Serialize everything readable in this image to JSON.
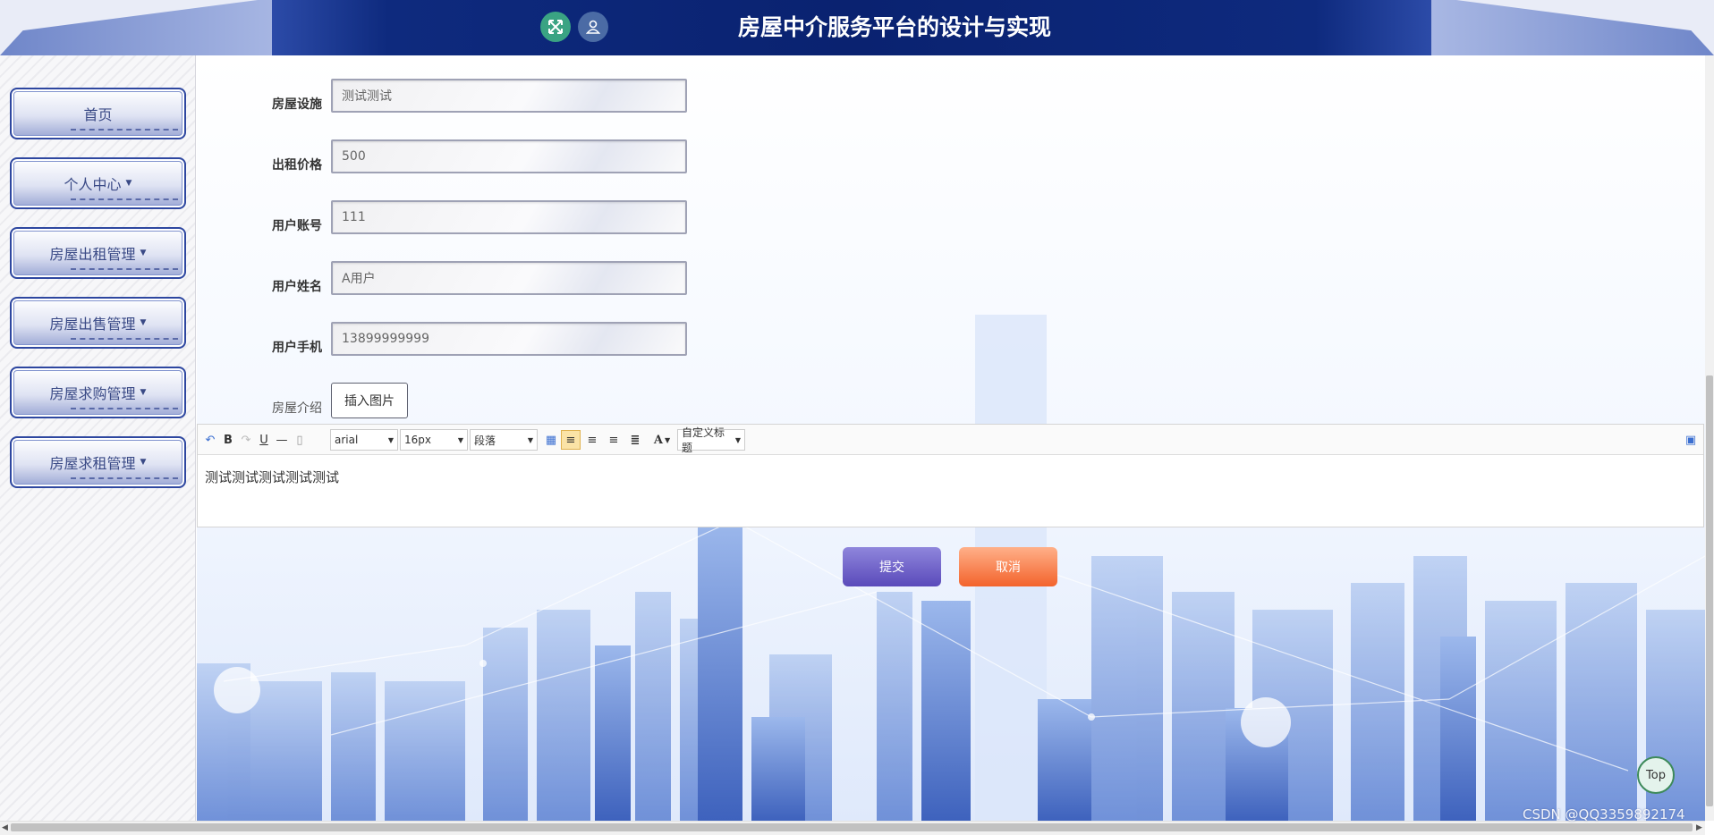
{
  "header": {
    "title": "房屋中介服务平台的设计与实现",
    "fullscreen_icon": "fullscreen-arrows-icon",
    "user_icon": "user-icon"
  },
  "sidebar": {
    "items": [
      {
        "label": "首页",
        "has_caret": false
      },
      {
        "label": "个人中心",
        "has_caret": true
      },
      {
        "label": "房屋出租管理",
        "has_caret": true
      },
      {
        "label": "房屋出售管理",
        "has_caret": true
      },
      {
        "label": "房屋求购管理",
        "has_caret": true
      },
      {
        "label": "房屋求租管理",
        "has_caret": true
      }
    ],
    "caret": "▼"
  },
  "form": {
    "fields": [
      {
        "label": "房屋设施",
        "value": "测试测试"
      },
      {
        "label": "出租价格",
        "value": "500"
      },
      {
        "label": "用户账号",
        "value": "111"
      },
      {
        "label": "用户姓名",
        "value": "A用户"
      },
      {
        "label": "用户手机",
        "value": "13899999999"
      }
    ],
    "intro_label": "房屋介绍",
    "insert_image_label": "插入图片",
    "submit_label": "提交",
    "cancel_label": "取消"
  },
  "editor": {
    "toolbar": {
      "undo_icon": "undo-icon",
      "bold": "B",
      "redo_icon": "redo-icon",
      "underline": "U",
      "hr_icon": "horizontal-rule-icon",
      "paste_icon": "paste-icon",
      "font_family": "arial",
      "font_size": "16px",
      "paragraph": "段落",
      "table_icon": "table-icon",
      "align_left_icon": "align-left-icon",
      "align_right_icon": "align-right-icon",
      "align_center_icon": "align-center-icon",
      "align_justify_icon": "align-justify-icon",
      "font_color": "A",
      "custom_title": "自定义标题",
      "fullscreen_icon": "editor-fullscreen-icon"
    },
    "content": "测试测试测试测试测试"
  },
  "top_button": "Top",
  "watermark": "CSDN @QQ3359892174"
}
